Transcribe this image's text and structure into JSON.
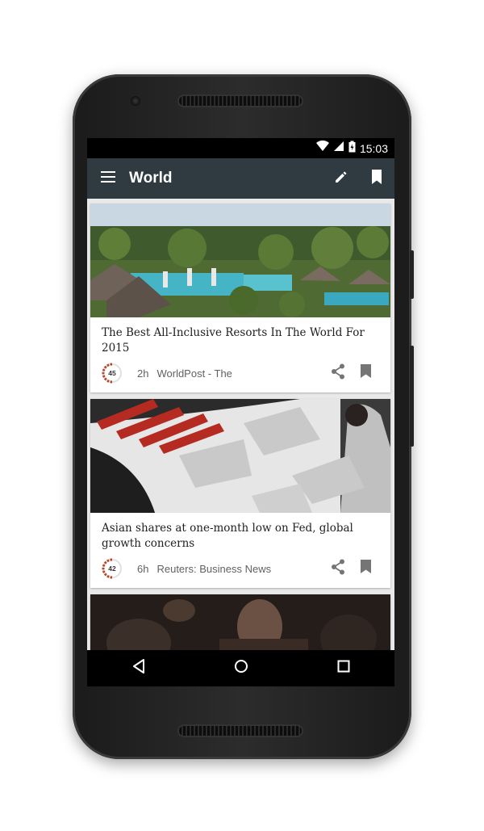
{
  "status_bar": {
    "time": "15:03"
  },
  "app_bar": {
    "title": "World"
  },
  "articles": [
    {
      "headline": "The Best All-Inclusive Resorts In The World For 2015",
      "score": "45",
      "age": "2h",
      "source": "WorldPost - The"
    },
    {
      "headline": "Asian shares at one-month low on Fed, global growth concerns",
      "score": "42",
      "age": "6h",
      "source": "Reuters: Business News"
    }
  ],
  "colors": {
    "app_bar": "#303b41",
    "status_bar": "#000000",
    "score_ring": "#b8452b",
    "icon_gray": "#757575"
  },
  "icons": [
    "wifi-icon",
    "signal-icon",
    "battery-charging-icon",
    "menu-icon",
    "edit-icon",
    "bookmark-icon",
    "share-icon",
    "back-icon",
    "home-icon",
    "recents-icon"
  ]
}
